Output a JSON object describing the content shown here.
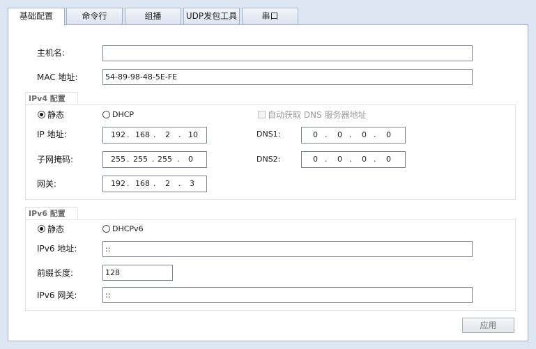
{
  "tabs": [
    "基础配置",
    "命令行",
    "组播",
    "UDP发包工具",
    "串口"
  ],
  "basic": {
    "hostname_label": "主机名:",
    "hostname_value": "",
    "mac_label": "MAC 地址:",
    "mac_value": "54-89-98-48-5E-FE"
  },
  "ipv4": {
    "title": "IPv4 配置",
    "static_label": "静态",
    "dhcp_label": "DHCP",
    "auto_dns_label": "自动获取 DNS 服务器地址",
    "ip_label": "IP 地址:",
    "ip": [
      "192",
      "168",
      "2",
      "10"
    ],
    "mask_label": "子网掩码:",
    "mask": [
      "255",
      "255",
      "255",
      "0"
    ],
    "gateway_label": "网关:",
    "gateway": [
      "192",
      "168",
      "2",
      "3"
    ],
    "dns1_label": "DNS1:",
    "dns1": [
      "0",
      "0",
      "0",
      "0"
    ],
    "dns2_label": "DNS2:",
    "dns2": [
      "0",
      "0",
      "0",
      "0"
    ]
  },
  "ipv6": {
    "title": "IPv6 配置",
    "static_label": "静态",
    "dhcp_label": "DHCPv6",
    "addr_label": "IPv6 地址:",
    "addr_value": "::",
    "prefix_label": "前缀长度:",
    "prefix_value": "128",
    "gateway_label": "IPv6 网关:",
    "gateway_value": "::"
  },
  "apply_label": "应用"
}
